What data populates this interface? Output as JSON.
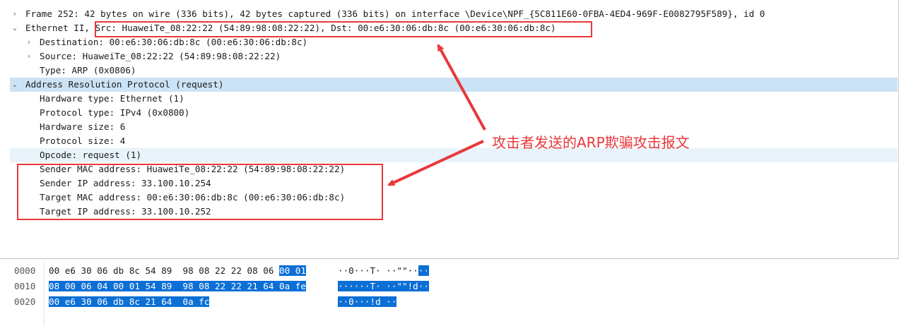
{
  "details": {
    "frame": "Frame 252: 42 bytes on wire (336 bits), 42 bytes captured (336 bits) on interface \\Device\\NPF_{5C811E60-0FBA-4ED4-969F-E0082795F589}, id 0",
    "ethernet_prefix": "Ethernet II, ",
    "ethernet_src_dst": "Src: HuaweiTe_08:22:22 (54:89:98:08:22:22), Dst: 00:e6:30:06:db:8c (00:e6:30:06:db:8c)",
    "destination": "Destination: 00:e6:30:06:db:8c (00:e6:30:06:db:8c)",
    "source": "Source: HuaweiTe_08:22:22 (54:89:98:08:22:22)",
    "type": "Type: ARP (0x0806)",
    "arp": "Address Resolution Protocol (request)",
    "hw_type": "Hardware type: Ethernet (1)",
    "proto_type": "Protocol type: IPv4 (0x0800)",
    "hw_size": "Hardware size: 6",
    "proto_size": "Protocol size: 4",
    "opcode": "Opcode: request (1)",
    "sender_mac": "Sender MAC address: HuaweiTe_08:22:22 (54:89:98:08:22:22)",
    "sender_ip": "Sender IP address: 33.100.10.254",
    "target_mac": "Target MAC address: 00:e6:30:06:db:8c (00:e6:30:06:db:8c)",
    "target_ip": "Target IP address: 33.100.10.252",
    "icons": {
      "collapsed": "chevron-right-icon",
      "expanded": "chevron-down-icon"
    }
  },
  "bytes": {
    "rows": [
      {
        "offset": "0000",
        "hex_plain": "00 e6 30 06 db 8c 54 89  98 08 22 22 08 06 ",
        "hex_sel": "00 01",
        "ascii_plain": "··0···T· ··\"\"··",
        "ascii_sel": "··"
      },
      {
        "offset": "0010",
        "hex_plain": "",
        "hex_sel": "08 00 06 04 00 01 54 89  98 08 22 22 21 64 0a fe",
        "ascii_plain": "",
        "ascii_sel": "······T· ··\"\"!d··"
      },
      {
        "offset": "0020",
        "hex_plain": "",
        "hex_sel": "00 e6 30 06 db 8c 21 64  0a fc",
        "ascii_plain": "",
        "ascii_sel": "··0···!d ··"
      }
    ]
  },
  "annotation": {
    "label": "攻击者发送的ARP欺骗攻击报文",
    "color": "#e8383b"
  },
  "colors": {
    "selected_row": "#cce3f5",
    "hover_row": "#e8f3fb",
    "byte_selection": "#0b6fd6"
  }
}
